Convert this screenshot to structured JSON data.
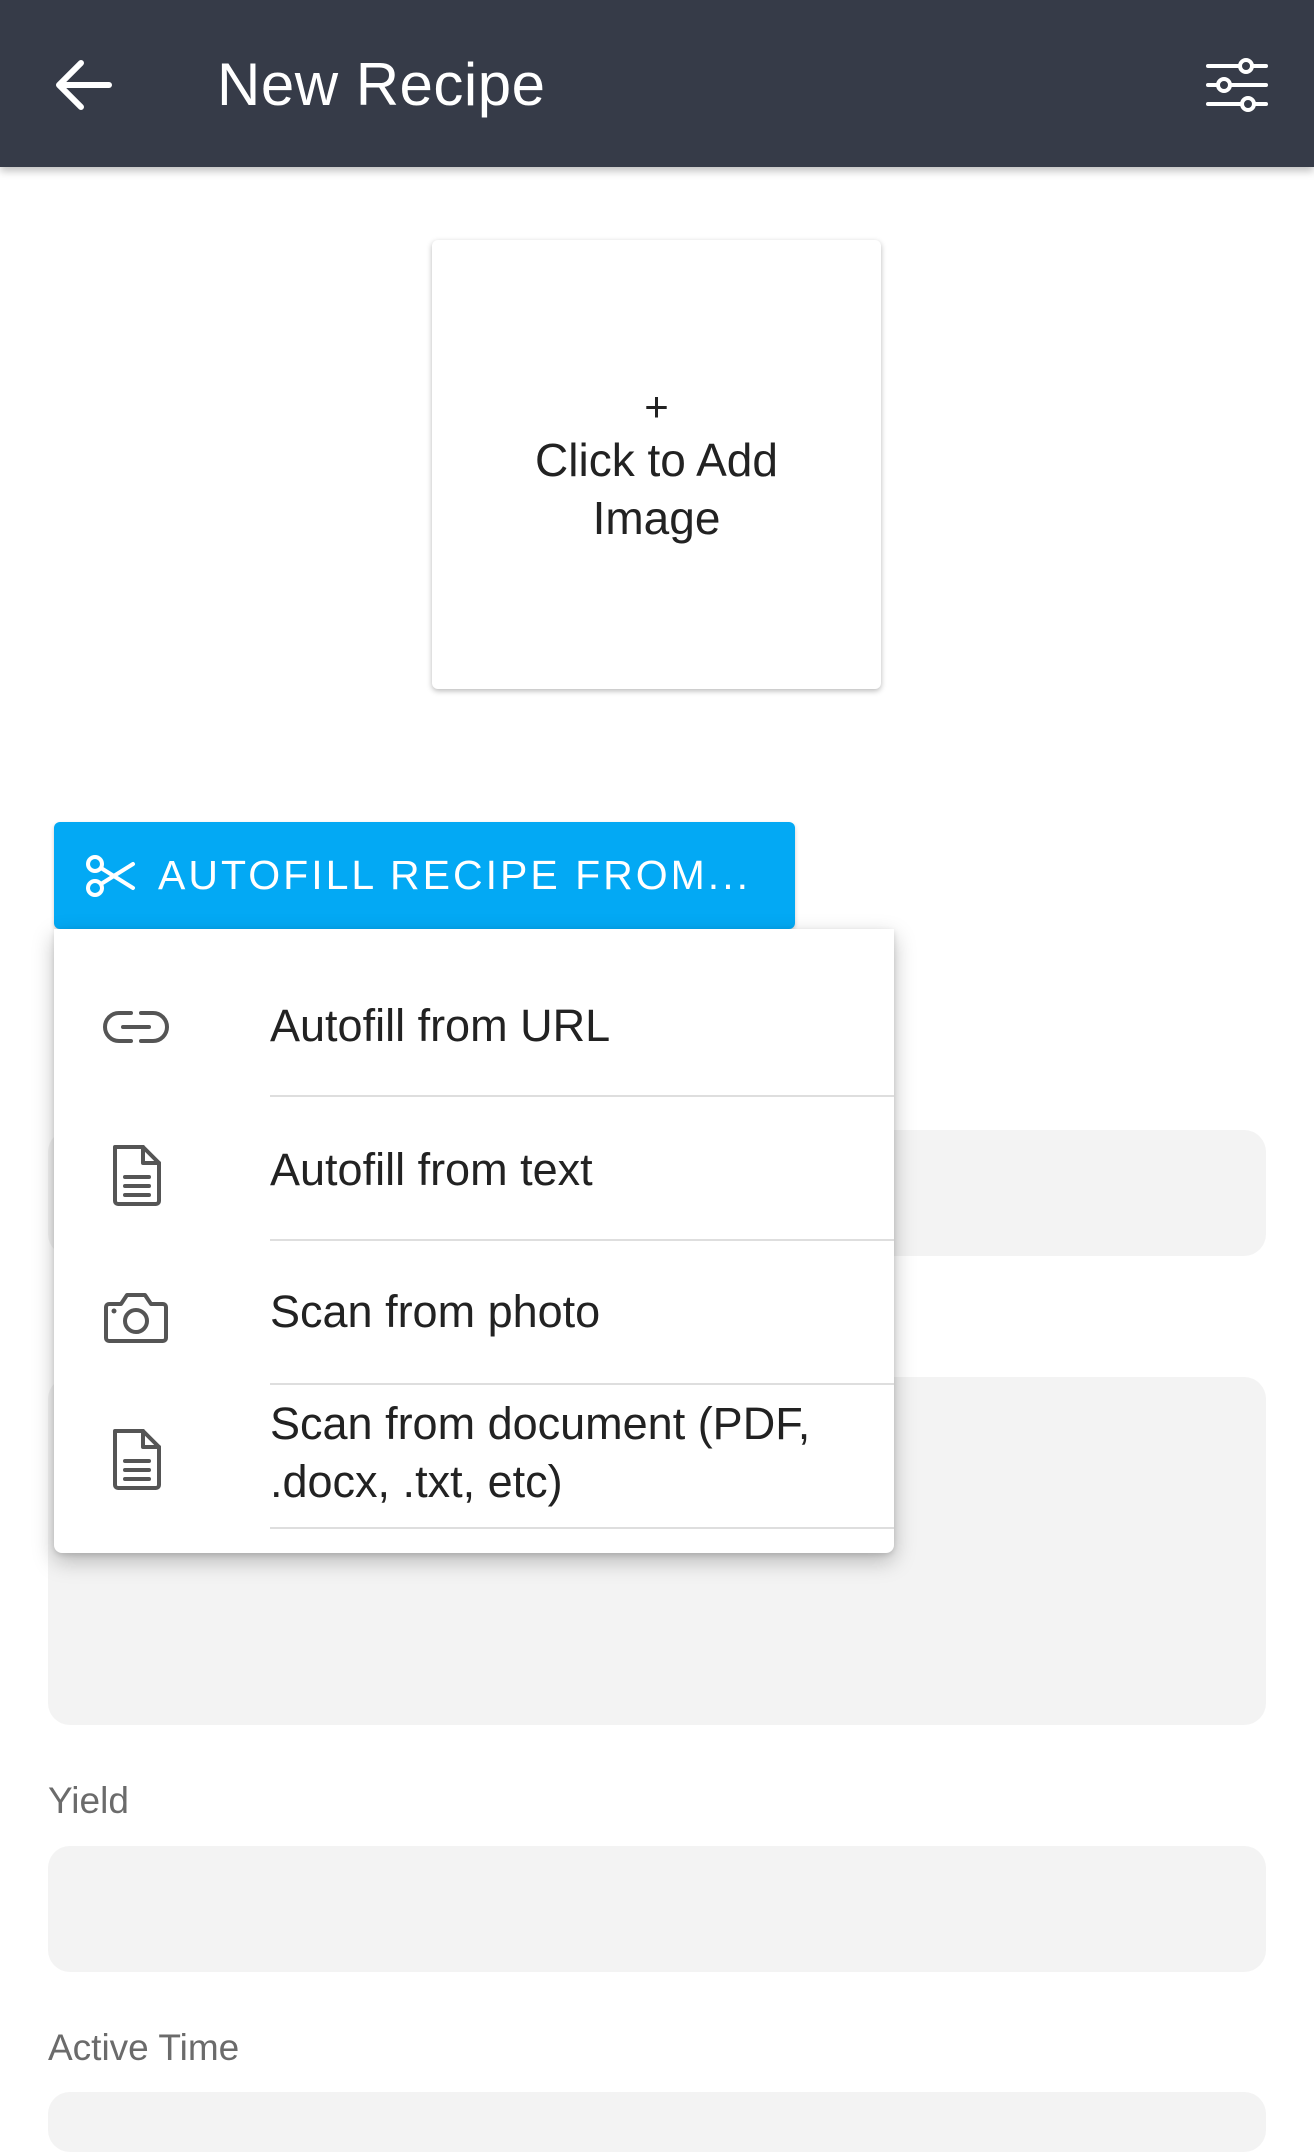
{
  "header": {
    "title": "New Recipe",
    "back_icon": "arrow-back-icon",
    "settings_icon": "sliders-icon",
    "background_color": "#363b48"
  },
  "image_picker": {
    "plus": "+",
    "label": "Click to Add Image"
  },
  "autofill": {
    "button_label": "AUTOFILL RECIPE FROM...",
    "button_icon": "scissors-icon",
    "button_color": "#03a9f4",
    "menu_items": [
      {
        "icon": "link-icon",
        "label": "Autofill from URL"
      },
      {
        "icon": "text-document-icon",
        "label": "Autofill from text"
      },
      {
        "icon": "camera-icon",
        "label": "Scan from photo"
      },
      {
        "icon": "document-icon",
        "label": "Scan from document (PDF, .docx, .txt, etc)"
      }
    ]
  },
  "form": {
    "yield_label": "Yield",
    "active_time_label": "Active Time"
  }
}
